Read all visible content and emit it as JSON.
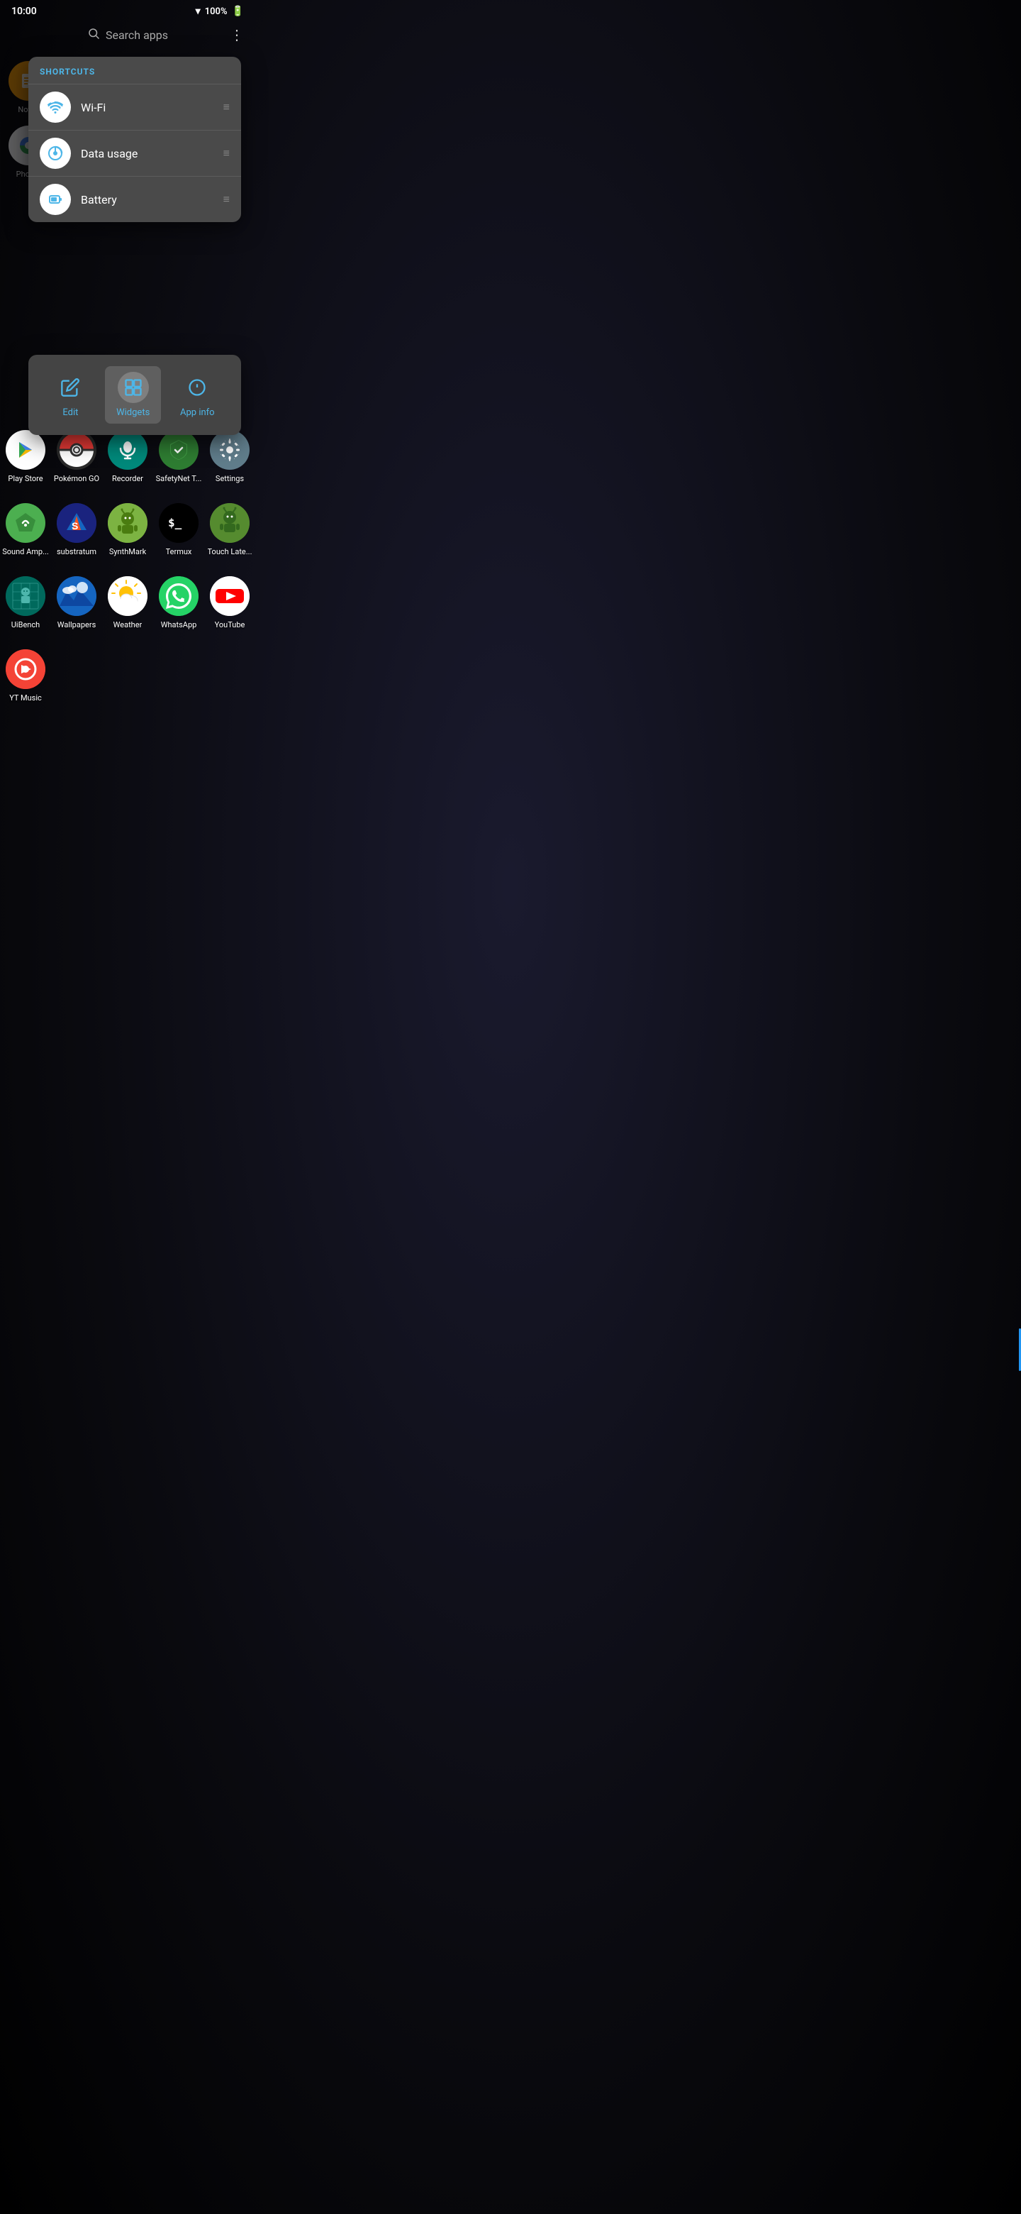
{
  "statusBar": {
    "time": "10:00",
    "battery": "100%"
  },
  "searchBar": {
    "placeholder": "Search apps"
  },
  "popup": {
    "header": "SHORTCUTS",
    "items": [
      {
        "id": "wifi",
        "label": "Wi-Fi"
      },
      {
        "id": "datausage",
        "label": "Data usage"
      },
      {
        "id": "battery",
        "label": "Battery"
      }
    ],
    "actions": [
      {
        "id": "edit",
        "label": "Edit"
      },
      {
        "id": "widgets",
        "label": "Widgets",
        "active": true
      },
      {
        "id": "appinfo",
        "label": "App info"
      }
    ]
  },
  "apps": [
    {
      "id": "notes",
      "label": "Notes",
      "row": 1
    },
    {
      "id": "photos",
      "label": "Photos",
      "row": 2
    },
    {
      "id": "playstore",
      "label": "Play Store",
      "row": 3
    },
    {
      "id": "pokemon",
      "label": "Pokémon GO",
      "row": 3
    },
    {
      "id": "recorder",
      "label": "Recorder",
      "row": 3
    },
    {
      "id": "safetynet",
      "label": "SafetyNet T...",
      "row": 3
    },
    {
      "id": "settings",
      "label": "Settings",
      "row": 3
    },
    {
      "id": "soundamp",
      "label": "Sound Amp...",
      "row": 4
    },
    {
      "id": "substratum",
      "label": "substratum",
      "row": 4
    },
    {
      "id": "synthmark",
      "label": "SynthMark",
      "row": 4
    },
    {
      "id": "termux",
      "label": "Termux",
      "row": 4
    },
    {
      "id": "touchlate",
      "label": "Touch Late...",
      "row": 4
    },
    {
      "id": "uibench",
      "label": "UiBench",
      "row": 5
    },
    {
      "id": "wallpapers",
      "label": "Wallpapers",
      "row": 5
    },
    {
      "id": "weather",
      "label": "Weather",
      "row": 5
    },
    {
      "id": "whatsapp",
      "label": "WhatsApp",
      "row": 5,
      "dot": true
    },
    {
      "id": "youtube",
      "label": "YouTube",
      "row": 5
    },
    {
      "id": "ytmusic",
      "label": "YT Music",
      "row": 6
    }
  ]
}
